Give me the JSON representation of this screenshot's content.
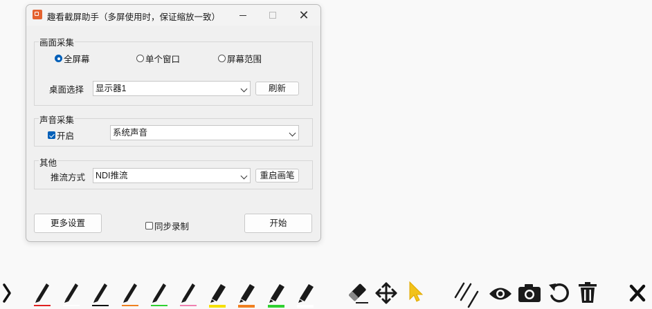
{
  "window": {
    "title": "趣看截屏助手（多屏使用时，保证缩放一致）"
  },
  "capture": {
    "legend": "画面采集",
    "modes": [
      {
        "label": "全屏幕",
        "selected": true
      },
      {
        "label": "单个窗口",
        "selected": false
      },
      {
        "label": "屏幕范围",
        "selected": false
      }
    ],
    "desktop_label": "桌面选择",
    "desktop_value": "显示器1",
    "refresh_label": "刷新"
  },
  "audio": {
    "legend": "声音采集",
    "enable_label": "开启",
    "enabled": true,
    "source_value": "系统声音"
  },
  "other": {
    "legend": "其他",
    "stream_label": "推流方式",
    "stream_value": "NDI推流",
    "restart_pen_label": "重启画笔"
  },
  "footer": {
    "more_settings_label": "更多设置",
    "sync_record_label": "同步录制",
    "sync_record_checked": false,
    "start_label": "开始"
  },
  "toolbar": {
    "pens": [
      {
        "icon": "pen-icon",
        "color": "#e02020"
      },
      {
        "icon": "pen-icon",
        "color": "#ffffff"
      },
      {
        "icon": "pen-icon",
        "color": "#111111"
      },
      {
        "icon": "pen-icon",
        "color": "#f08020"
      },
      {
        "icon": "pen-icon",
        "color": "#30d030"
      },
      {
        "icon": "pen-icon",
        "color": "#f080b0"
      },
      {
        "icon": "highlighter-icon",
        "color": "#f5e000"
      },
      {
        "icon": "highlighter-icon",
        "color": "#f08020"
      },
      {
        "icon": "highlighter-icon",
        "color": "#30d030"
      },
      {
        "icon": "highlighter-icon",
        "color": "#ffffff"
      }
    ],
    "tools": [
      "expand-arrow-icon",
      "eraser-icon",
      "move-icon",
      "pointer-icon",
      "lines-icon",
      "eye-icon",
      "camera-icon",
      "undo-icon",
      "trash-icon",
      "close-icon"
    ]
  }
}
